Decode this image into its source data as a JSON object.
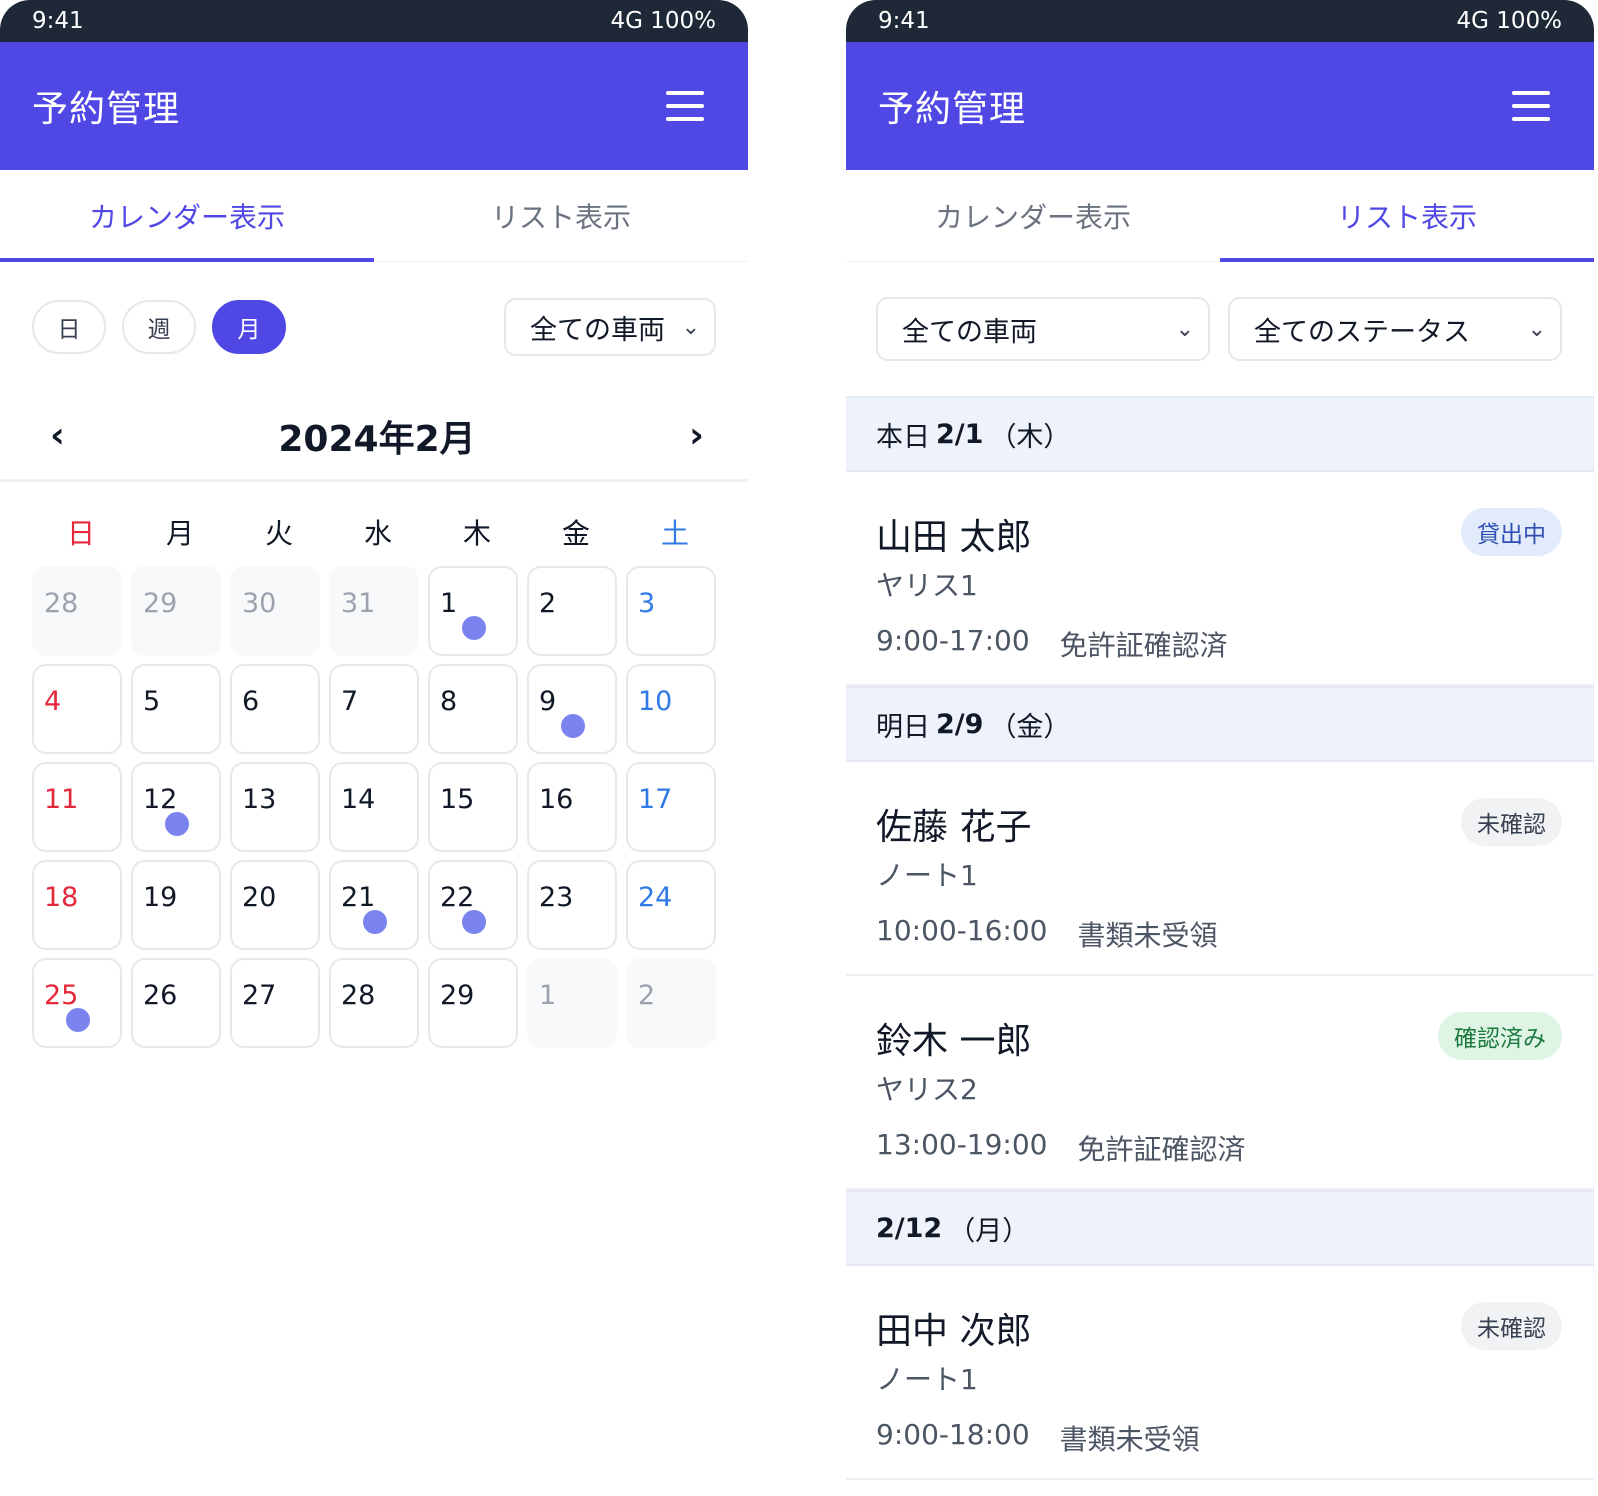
{
  "status_bar": {
    "time": "9:41",
    "signal": "4G 100%"
  },
  "app": {
    "title": "予約管理"
  },
  "tabs": {
    "calendar": "カレンダー表示",
    "list": "リスト表示"
  },
  "calendar_screen": {
    "view_buttons": [
      "日",
      "週",
      "月"
    ],
    "active_view": "月",
    "vehicle_filter": "全ての車両",
    "month_title": "2024年2月",
    "weekdays": [
      "日",
      "月",
      "火",
      "水",
      "木",
      "金",
      "土"
    ],
    "weeks": [
      [
        {
          "n": "28",
          "out": true
        },
        {
          "n": "29",
          "out": true
        },
        {
          "n": "30",
          "out": true
        },
        {
          "n": "31",
          "out": true
        },
        {
          "n": "1",
          "dot": true
        },
        {
          "n": "2"
        },
        {
          "n": "3"
        }
      ],
      [
        {
          "n": "4"
        },
        {
          "n": "5"
        },
        {
          "n": "6"
        },
        {
          "n": "7"
        },
        {
          "n": "8"
        },
        {
          "n": "9",
          "dot": true
        },
        {
          "n": "10"
        }
      ],
      [
        {
          "n": "11"
        },
        {
          "n": "12",
          "dot": true
        },
        {
          "n": "13"
        },
        {
          "n": "14"
        },
        {
          "n": "15"
        },
        {
          "n": "16"
        },
        {
          "n": "17"
        }
      ],
      [
        {
          "n": "18"
        },
        {
          "n": "19"
        },
        {
          "n": "20"
        },
        {
          "n": "21",
          "dot": true
        },
        {
          "n": "22",
          "dot": true
        },
        {
          "n": "23"
        },
        {
          "n": "24"
        }
      ],
      [
        {
          "n": "25",
          "dot": true
        },
        {
          "n": "26"
        },
        {
          "n": "27"
        },
        {
          "n": "28"
        },
        {
          "n": "29"
        },
        {
          "n": "1",
          "out": true
        },
        {
          "n": "2",
          "out": true
        }
      ]
    ]
  },
  "list_screen": {
    "vehicle_filter": "全ての車両",
    "status_filter": "全てのステータス",
    "sections": [
      {
        "prefix": "本日",
        "date": "2/1",
        "weekday": "（木）",
        "bookings": [
          {
            "name": "山田 太郎",
            "vehicle": "ヤリス1",
            "time": "9:00-17:00",
            "note": "免許証確認済",
            "status": "貸出中",
            "status_color": "blue"
          }
        ]
      },
      {
        "prefix": "明日",
        "date": "2/9",
        "weekday": "（金）",
        "bookings": [
          {
            "name": "佐藤 花子",
            "vehicle": "ノート1",
            "time": "10:00-16:00",
            "note": "書類未受領",
            "status": "未確認",
            "status_color": "gray"
          },
          {
            "name": "鈴木 一郎",
            "vehicle": "ヤリス2",
            "time": "13:00-19:00",
            "note": "免許証確認済",
            "status": "確認済み",
            "status_color": "green"
          }
        ]
      },
      {
        "prefix": "",
        "date": "2/12",
        "weekday": "（月）",
        "bookings": [
          {
            "name": "田中 次郎",
            "vehicle": "ノート1",
            "time": "9:00-18:00",
            "note": "書類未受領",
            "status": "未確認",
            "status_color": "gray"
          }
        ]
      }
    ]
  },
  "colors": {
    "primary": "#5048e5",
    "status_bar": "#1e2836",
    "sunday": "#e5283c",
    "saturday": "#2f7ae5",
    "dot": "#7b83ee",
    "section_bg": "#eef2fa"
  },
  "icons": {
    "menu": "hamburger-icon",
    "select": "chevron-down-icon",
    "prev": "chevron-left-icon",
    "next": "chevron-right-icon"
  }
}
